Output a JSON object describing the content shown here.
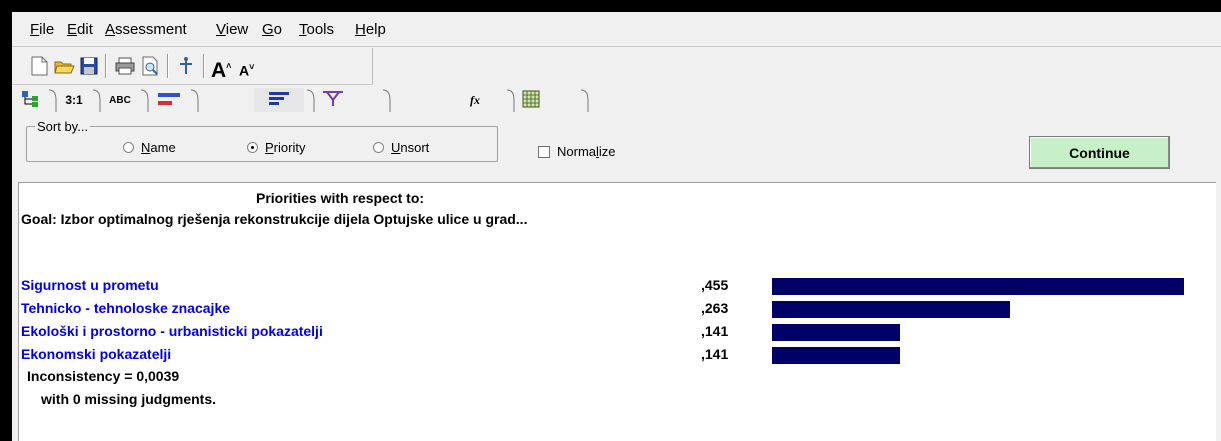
{
  "menu": [
    "File",
    "Edit",
    "Assessment",
    "View",
    "Go",
    "Tools",
    "Help"
  ],
  "toolbar_icons": [
    "new-file-icon",
    "open-folder-icon",
    "save-icon",
    "print-icon",
    "print-preview-icon",
    "hierarchy-icon",
    "font-larger-icon",
    "font-smaller-icon"
  ],
  "tabs": [
    {
      "icon": "tree-view-icon",
      "label": ""
    },
    {
      "icon": "",
      "label": "3:1"
    },
    {
      "icon": "",
      "label": "ABC"
    },
    {
      "icon": "bar-graph-icon",
      "label": ""
    },
    {
      "icon": "priority-sort-icon",
      "label": ""
    },
    {
      "icon": "branch-icon",
      "label": ""
    },
    {
      "icon": "formula-icon",
      "label": "fx"
    },
    {
      "icon": "grid-icon",
      "label": ""
    }
  ],
  "sort": {
    "legend": "Sort by...",
    "options": [
      {
        "label": "Name",
        "accel": "N",
        "rest": "ame",
        "selected": false
      },
      {
        "label": "Priority",
        "accel": "P",
        "rest": "riority",
        "selected": true
      },
      {
        "label": "Unsort",
        "accel": "U",
        "rest": "nsort",
        "selected": false
      }
    ]
  },
  "normalize": {
    "label_pre": "Norma",
    "accel": "l",
    "label_post": "ize",
    "checked": false
  },
  "continue_label": "Continue",
  "panel": {
    "heading": "Priorities with respect to:",
    "goal": "Goal: Izbor optimalnog rješenja rekonstrukcije dijela Optujske ulice u grad...",
    "criteria": [
      {
        "name": "Sigurnost u prometu",
        "value_label": ",455",
        "value": 0.455
      },
      {
        "name": "Tehnicko - tehnoloske znacajke",
        "value_label": ",263",
        "value": 0.263
      },
      {
        "name": "Ekološki i prostorno - urbanisticki pokazatelji",
        "value_label": ",141",
        "value": 0.141
      },
      {
        "name": "Ekonomski pokazatelji",
        "value_label": ",141",
        "value": 0.141
      }
    ],
    "inconsistency": "Inconsistency = 0,0039",
    "missing": "with 0  missing judgments."
  },
  "colors": {
    "bar": "#000066",
    "criteria_text": "#0000ee",
    "continue_bg": "#c8f0c8"
  }
}
